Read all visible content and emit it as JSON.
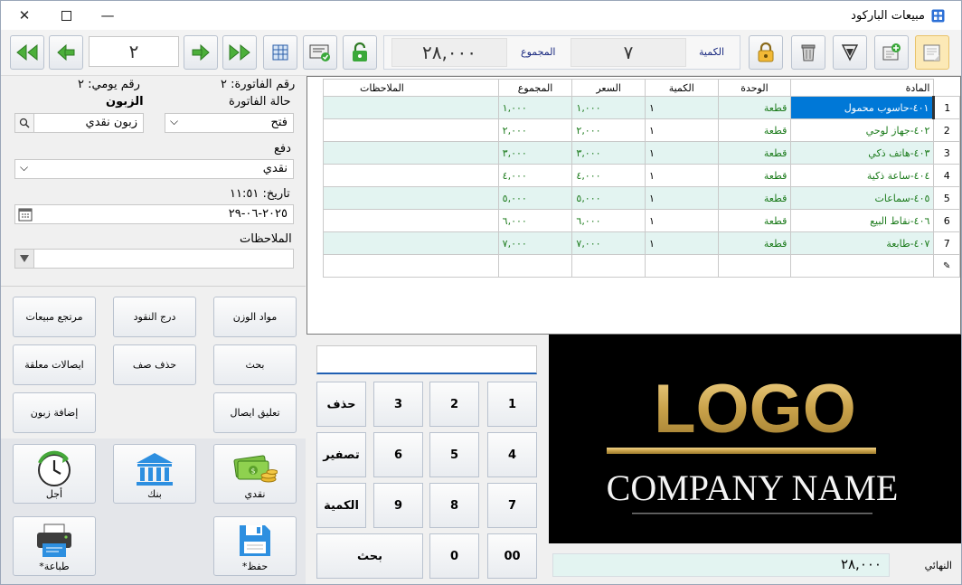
{
  "window": {
    "title": "مبيعات الباركود"
  },
  "toolbar": {
    "invoice_number": "٢",
    "total_label": "المجموع",
    "total_value": "٢٨,٠٠٠",
    "qty_label": "الكمية",
    "qty_value": "٧"
  },
  "invoice": {
    "number_label": "رقم الفاتورة: ٢",
    "daily_label": "رقم يومي: ٢",
    "status_label": "حالة الفاتورة",
    "status_value": "فتح",
    "customer_label": "الزبون",
    "customer_value": "زبون نقدي",
    "payment_label": "دفع",
    "payment_value": "نقدي",
    "date_label": "تاريخ: ١١:٥١",
    "date_value": "٢٠٢٥-٠٦-٢٩",
    "notes_label": "الملاحظات"
  },
  "actions": [
    "مواد الوزن",
    "درج النقود",
    "مرتجع مبيعات",
    "بحث",
    "حذف صف",
    "ايصالات معلقة",
    "تعليق ايصال",
    "إضافة زبون"
  ],
  "payments": {
    "cash": "نقدي",
    "bank": "بنك",
    "deferred": "أجل"
  },
  "file_actions": {
    "save": "حفظ*",
    "print": "طباعة*"
  },
  "grid": {
    "headers": [
      "المادة",
      "الوحدة",
      "الكمية",
      "السعر",
      "المجموع",
      "الملاحظات"
    ],
    "rows": [
      {
        "num": "1",
        "item": "٤٠١-حاسوب محمول",
        "unit": "قطعة",
        "qty": "١",
        "price": "١,٠٠٠",
        "total": "١,٠٠٠"
      },
      {
        "num": "2",
        "item": "٤٠٢-جهاز لوحي",
        "unit": "قطعة",
        "qty": "١",
        "price": "٢,٠٠٠",
        "total": "٢,٠٠٠"
      },
      {
        "num": "3",
        "item": "٤٠٣-هاتف ذكي",
        "unit": "قطعة",
        "qty": "١",
        "price": "٣,٠٠٠",
        "total": "٣,٠٠٠"
      },
      {
        "num": "4",
        "item": "٤٠٤-ساعة ذكية",
        "unit": "قطعة",
        "qty": "١",
        "price": "٤,٠٠٠",
        "total": "٤,٠٠٠"
      },
      {
        "num": "5",
        "item": "٤٠٥-سماعات",
        "unit": "قطعة",
        "qty": "١",
        "price": "٥,٠٠٠",
        "total": "٥,٠٠٠"
      },
      {
        "num": "6",
        "item": "٤٠٦-نقاط البيع",
        "unit": "قطعة",
        "qty": "١",
        "price": "٦,٠٠٠",
        "total": "٦,٠٠٠"
      },
      {
        "num": "7",
        "item": "٤٠٧-طابعة",
        "unit": "قطعة",
        "qty": "١",
        "price": "٧,٠٠٠",
        "total": "٧,٠٠٠"
      }
    ]
  },
  "keypad": {
    "k1": "1",
    "k2": "2",
    "k3": "3",
    "delete": "حذف",
    "k4": "4",
    "k5": "5",
    "k6": "6",
    "reset": "تصفير",
    "k7": "7",
    "k8": "8",
    "k9": "9",
    "quantity": "الكمية",
    "k00": "00",
    "k0": "0",
    "search": "بحث"
  },
  "logo": {
    "main": "LOGO",
    "sub": "COMPANY NAME"
  },
  "final": {
    "label": "النهائي",
    "value": "٢٨,٠٠٠"
  }
}
